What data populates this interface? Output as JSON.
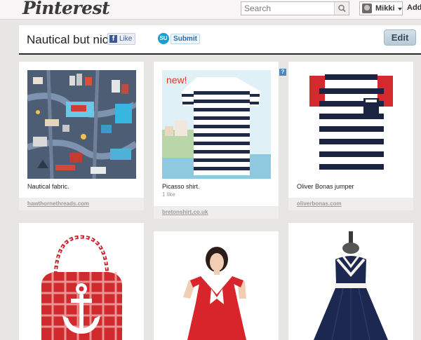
{
  "header": {
    "logo": "Pinterest",
    "search": {
      "placeholder": "Search"
    },
    "user": {
      "name": "Mikki"
    },
    "add_label": "Add"
  },
  "board": {
    "title": "Nautical but nice",
    "like_label": "Like",
    "submit_label": "Submit",
    "stumble_badge": "SU",
    "edit_label": "Edit"
  },
  "pins": [
    {
      "description": "Nautical fabric.",
      "source": "hawthornethreads.com",
      "image": "nautical-map-fabric"
    },
    {
      "description": "Picasso shirt.",
      "likes": "1 like",
      "source": "bretonshirt.co.uk",
      "image": "striped-breton-shirt",
      "badge": "new!"
    },
    {
      "description": "Oliver Bonas jumper",
      "source": "oliverbonas.com",
      "image": "striped-jumper"
    },
    {
      "description": "",
      "image": "anchor-gingham-bag"
    },
    {
      "description": "",
      "image": "sailor-dress-model"
    },
    {
      "description": "",
      "image": "navy-halter-dress"
    }
  ],
  "help_badge": "?",
  "colors": {
    "brand_red": "#cb2027",
    "navy": "#1c2541",
    "edit_blue": "#b7cad6"
  }
}
